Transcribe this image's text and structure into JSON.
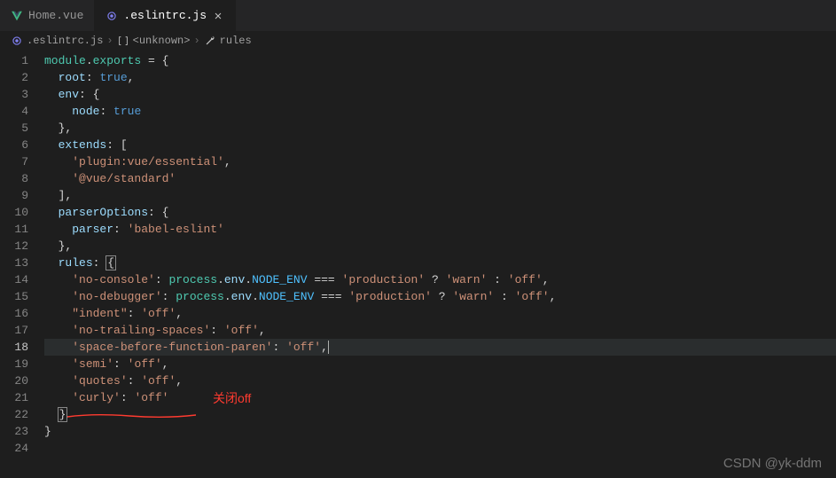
{
  "tabs": [
    {
      "label": "Home.vue",
      "active": false,
      "iconColor": "#41b883"
    },
    {
      "label": ".eslintrc.js",
      "active": true,
      "iconColor": "#cbcb41"
    }
  ],
  "breadcrumb": {
    "file": ".eslintrc.js",
    "sym1": "<unknown>",
    "sym2": "rules"
  },
  "lineCount": 24,
  "currentLine": 18,
  "code": {
    "l1": {
      "a": "module",
      "b": ".",
      "c": "exports",
      "d": " = {"
    },
    "l2": {
      "a": "root",
      "b": ": ",
      "c": "true",
      "d": ","
    },
    "l3": {
      "a": "env",
      "b": ": {"
    },
    "l4": {
      "a": "node",
      "b": ": ",
      "c": "true"
    },
    "l5": {
      "a": "},"
    },
    "l6": {
      "a": "extends",
      "b": ": ["
    },
    "l7": {
      "a": "'plugin:vue/essential'",
      "b": ","
    },
    "l8": {
      "a": "'@vue/standard'"
    },
    "l9": {
      "a": "],"
    },
    "l10": {
      "a": "parserOptions",
      "b": ": {"
    },
    "l11": {
      "a": "parser",
      "b": ": ",
      "c": "'babel-eslint'"
    },
    "l12": {
      "a": "},"
    },
    "l13": {
      "a": "rules",
      "b": ": ",
      "c": "{"
    },
    "l14": {
      "a": "'no-console'",
      "b": ": ",
      "c": "process",
      "d": ".",
      "e": "env",
      "f": ".",
      "g": "NODE_ENV",
      "h": " === ",
      "i": "'production'",
      "j": " ? ",
      "k": "'warn'",
      "l": " : ",
      "m": "'off'",
      "n": ","
    },
    "l15": {
      "a": "'no-debugger'",
      "b": ": ",
      "c": "process",
      "d": ".",
      "e": "env",
      "f": ".",
      "g": "NODE_ENV",
      "h": " === ",
      "i": "'production'",
      "j": " ? ",
      "k": "'warn'",
      "l": " : ",
      "m": "'off'",
      "n": ","
    },
    "l16": {
      "a": "\"indent\"",
      "b": ": ",
      "c": "'off'",
      "d": ","
    },
    "l17": {
      "a": "'no-trailing-spaces'",
      "b": ": ",
      "c": "'off'",
      "d": ","
    },
    "l18": {
      "a": "'space-before-function-paren'",
      "b": ": ",
      "c": "'off'",
      "d": ","
    },
    "l19": {
      "a": "'semi'",
      "b": ": ",
      "c": "'off'",
      "d": ","
    },
    "l20": {
      "a": "'quotes'",
      "b": ": ",
      "c": "'off'",
      "d": ","
    },
    "l21": {
      "a": "'curly'",
      "b": ": ",
      "c": "'off'"
    },
    "l22": {
      "a": "}"
    },
    "l23": {
      "a": "}"
    }
  },
  "annotation": "关闭off",
  "watermark": "CSDN @yk-ddm"
}
